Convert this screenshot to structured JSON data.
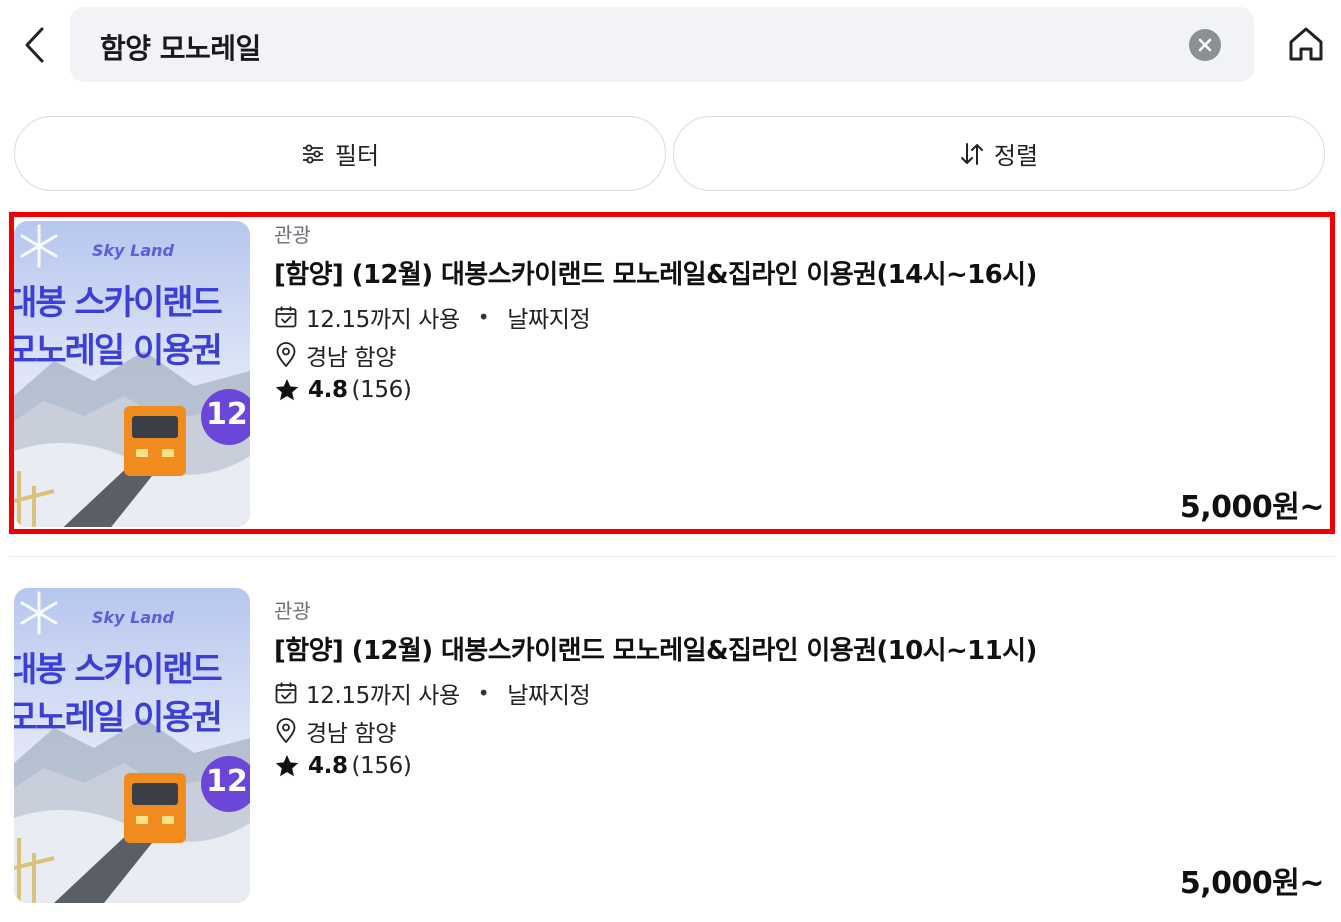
{
  "header": {
    "back_icon": "chevron-left-icon",
    "search_value": "함양 모노레일",
    "clear_icon": "clear-circle-icon",
    "home_icon": "home-icon"
  },
  "toolbar": {
    "filter_label": "필터",
    "filter_icon": "sliders-icon",
    "sort_label": "정렬",
    "sort_icon": "sort-arrows-icon"
  },
  "thumbnail": {
    "brand": "Sky Land",
    "line1": "대봉 스카이랜드",
    "line2": "모노레일 이용권",
    "badge": "12"
  },
  "results": [
    {
      "category": "관광",
      "title": "[함양] (12월) 대봉스카이랜드 모노레일&집라인 이용권(14시~16시)",
      "valid_until": "12.15까지 사용",
      "date_type": "날짜지정",
      "location": "경남 함양",
      "rating": "4.8",
      "review_count": "(156)",
      "price": "5,000원~"
    },
    {
      "category": "관광",
      "title": "[함양] (12월) 대봉스카이랜드 모노레일&집라인 이용권(10시~11시)",
      "valid_until": "12.15까지 사용",
      "date_type": "날짜지정",
      "location": "경남 함양",
      "rating": "4.8",
      "review_count": "(156)",
      "price": "5,000원~"
    }
  ],
  "colors": {
    "highlight": "#f00000",
    "search_bg": "#f1f3f6",
    "thumb_text": "#3b3fd6",
    "badge_bg": "#6a47d8"
  }
}
